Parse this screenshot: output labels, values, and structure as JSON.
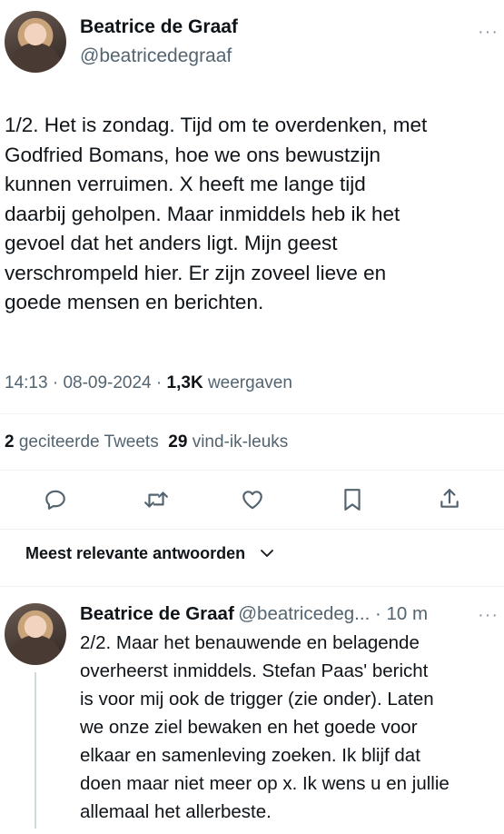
{
  "tweet": {
    "author_name": "Beatrice de Graaf",
    "author_handle": "@beatricedegraaf",
    "more_label": "···",
    "text": "1/2. Het is zondag. Tijd om te overdenken, met\nGodfried Bomans, hoe we ons bewustzijn\nkunnen verruimen. X heeft me lange tijd\ndaarbij geholpen. Maar inmiddels heb ik het\ngevoel dat het anders ligt. Mijn geest\nverschrompeld hier. Er zijn zoveel lieve en\ngoede mensen en berichten.",
    "time": "14:13",
    "dot1": " · ",
    "date": "08-09-2024",
    "dot2": " · ",
    "views_count": "1,3K",
    "views_label": " weergaven",
    "quote_count": "2",
    "quote_label": " geciteerde Tweets",
    "like_count": "29",
    "like_label": " vind-ik-leuks"
  },
  "actions": {
    "icons": [
      "reply-icon",
      "retweet-icon",
      "like-icon",
      "bookmark-icon",
      "share-icon"
    ]
  },
  "sort": {
    "label": "Meest relevante antwoorden"
  },
  "reply": {
    "author_name": "Beatrice de Graaf",
    "author_handle": "@beatricedeg...",
    "time": " · 10 m",
    "more_label": "···",
    "text": "2/2. Maar het benauwende en belagende\noverheerst inmiddels. Stefan Paas' bericht\nis voor mij ook de trigger (zie onder). Laten\nwe onze ziel bewaken en het goede voor\nelkaar en samenleving zoeken. Ik blijf dat\ndoen maar niet meer op x. Ik wens u en jullie\nallemaal het allerbeste."
  },
  "colors": {
    "text": "#0f1419",
    "secondary": "#536471",
    "divider": "#eff3f4",
    "thread_line": "#cfd9de"
  }
}
